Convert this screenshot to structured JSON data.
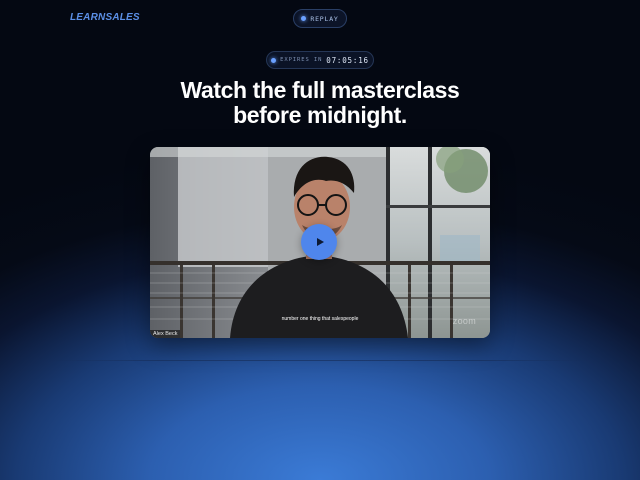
{
  "header": {
    "logo_text": "LEARNSALES",
    "replay_label": "REPLAY"
  },
  "countdown": {
    "label": "EXPIRES IN",
    "time": "07:05:16"
  },
  "hero": {
    "headline_line1": "Watch the full masterclass",
    "headline_line2": "before midnight."
  },
  "video": {
    "caption": "number one thing that salespeople",
    "speaker_name": "Alex Beck",
    "watermark": "zoom"
  },
  "colors": {
    "accent": "#4f86ec",
    "logo": "#5b8fe6",
    "background_dark": "#050a16",
    "background_glow": "#3b7bd6"
  },
  "icons": {
    "replay": "dot-icon",
    "countdown": "dot-icon",
    "play": "play-icon"
  }
}
